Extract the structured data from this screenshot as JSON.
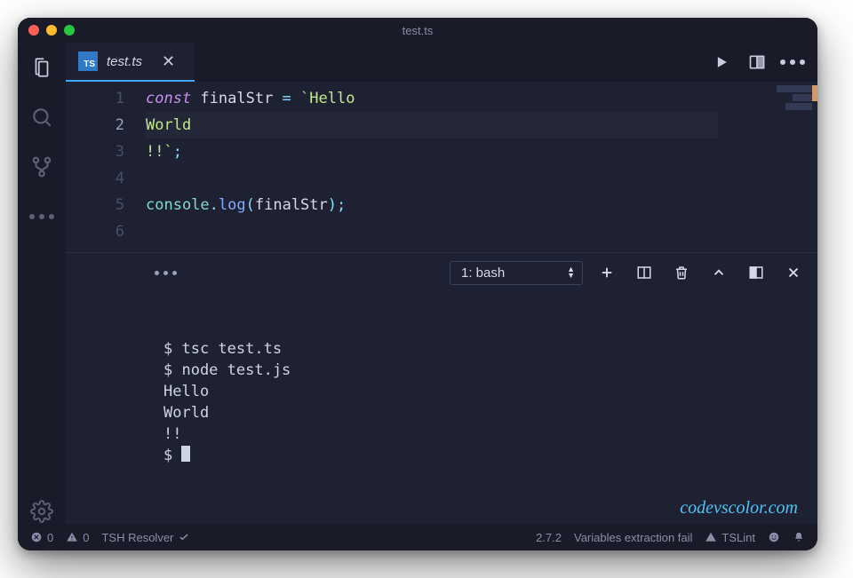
{
  "window": {
    "title": "test.ts"
  },
  "tab": {
    "filename": "test.ts",
    "language_badge": "TS"
  },
  "editor": {
    "lines": [
      {
        "n": "1",
        "tokens": [
          [
            "kw",
            "const"
          ],
          [
            "var",
            " finalStr "
          ],
          [
            "op",
            "="
          ],
          [
            "str",
            " `Hello"
          ]
        ]
      },
      {
        "n": "2",
        "current": true,
        "tokens": [
          [
            "str",
            "World"
          ]
        ]
      },
      {
        "n": "3",
        "tokens": [
          [
            "str",
            "!!`"
          ],
          [
            "punc",
            ";"
          ]
        ]
      },
      {
        "n": "4",
        "tokens": []
      },
      {
        "n": "5",
        "tokens": [
          [
            "obj",
            "console"
          ],
          [
            "punc",
            "."
          ],
          [
            "prop",
            "log"
          ],
          [
            "punc",
            "("
          ],
          [
            "arg",
            "finalStr"
          ],
          [
            "punc",
            ")"
          ],
          [
            "punc",
            ";"
          ]
        ]
      },
      {
        "n": "6",
        "tokens": []
      }
    ]
  },
  "terminal": {
    "selector_label": "1: bash",
    "lines": [
      "$ tsc test.ts",
      "$ node test.js",
      "Hello",
      "World",
      "!!",
      "$ "
    ]
  },
  "statusbar": {
    "errors": "0",
    "warnings": "0",
    "resolver": "TSH Resolver",
    "version": "2.7.2",
    "message": "Variables extraction fail",
    "lint": "TSLint"
  },
  "watermark": "codevscolor.com"
}
